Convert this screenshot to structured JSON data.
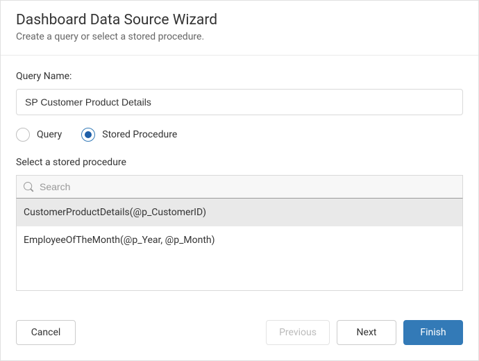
{
  "header": {
    "title": "Dashboard Data Source Wizard",
    "subtitle": "Create a query or select a stored procedure."
  },
  "queryName": {
    "label": "Query Name:",
    "value": "SP Customer Product Details"
  },
  "radios": {
    "query": {
      "label": "Query",
      "checked": false
    },
    "storedProcedure": {
      "label": "Stored Procedure",
      "checked": true
    }
  },
  "procedureSelect": {
    "label": "Select a stored procedure",
    "searchPlaceholder": "Search",
    "items": [
      {
        "label": "CustomerProductDetails(@p_CustomerID)",
        "selected": true
      },
      {
        "label": "EmployeeOfTheMonth(@p_Year, @p_Month)",
        "selected": false
      }
    ]
  },
  "footer": {
    "cancel": "Cancel",
    "previous": "Previous",
    "next": "Next",
    "finish": "Finish"
  }
}
